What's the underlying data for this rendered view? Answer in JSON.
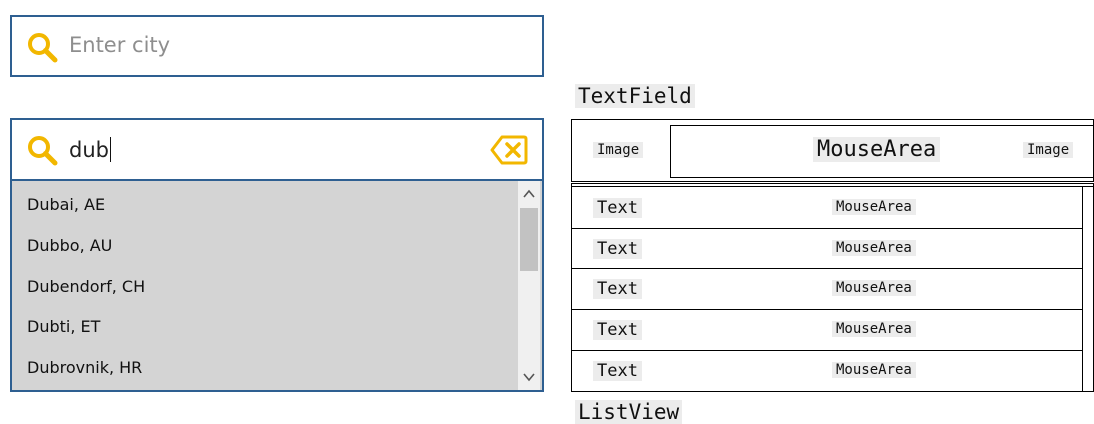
{
  "search_empty": {
    "placeholder": "Enter city"
  },
  "search_active": {
    "value": "dub"
  },
  "results": [
    "Dubai, AE",
    "Dubbo, AU",
    "Dubendorf, CH",
    "Dubti, ET",
    "Dubrovnik, HR"
  ],
  "diagram": {
    "textfield_label": "TextField",
    "left_image": "Image",
    "mouse_area": "MouseArea",
    "right_image": "Image",
    "row_text": "Text",
    "row_mouse": "MouseArea",
    "listview_label": "ListView"
  },
  "colors": {
    "accent_border": "#2e5f91",
    "icon_yellow": "#f2b700",
    "list_bg": "#d4d4d4"
  }
}
